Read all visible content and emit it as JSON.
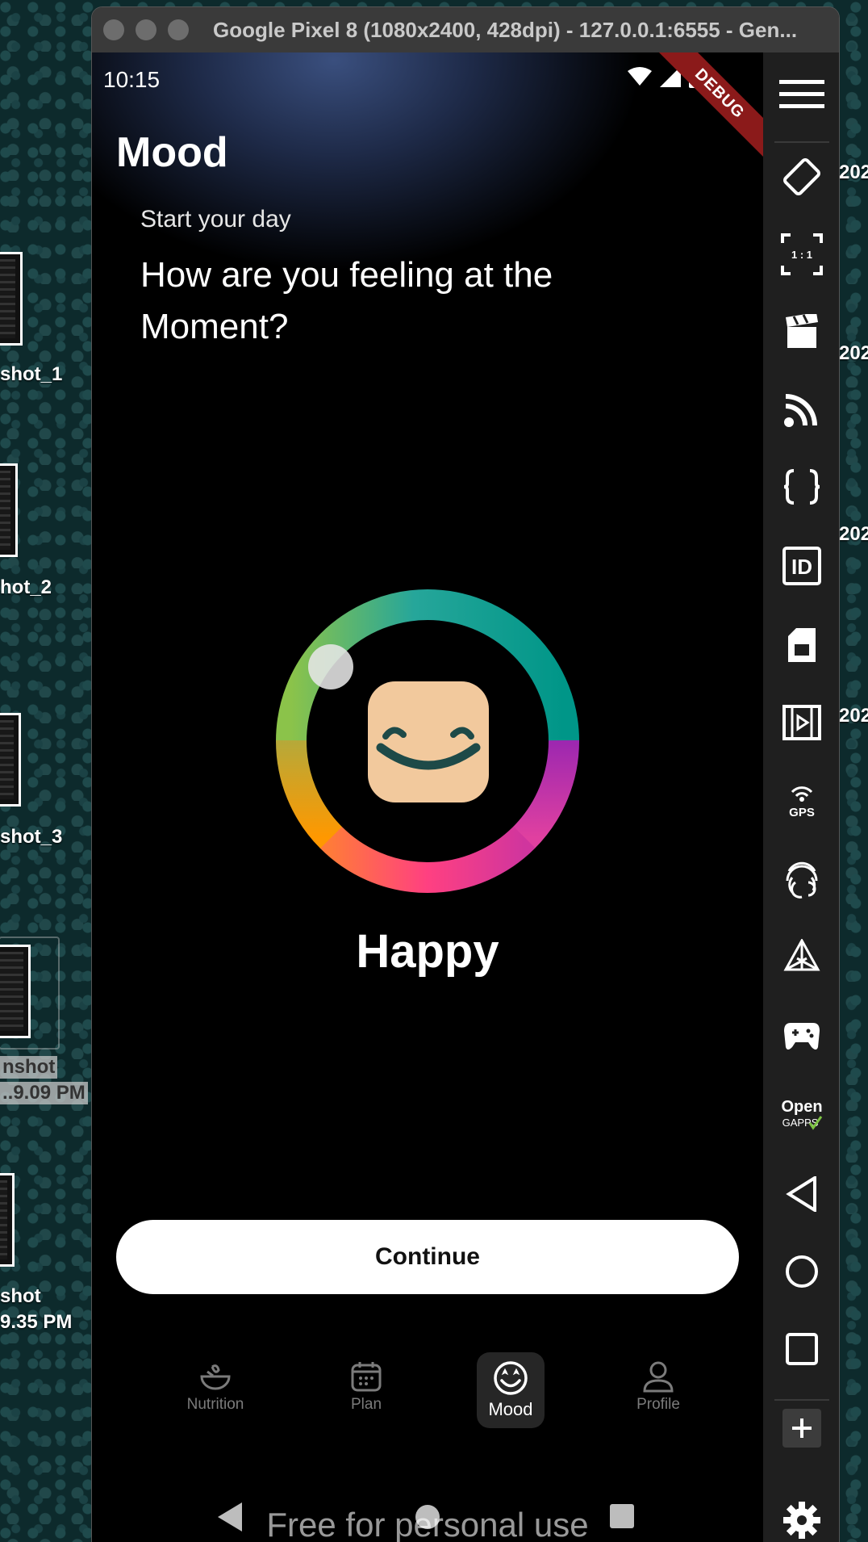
{
  "window": {
    "title": "Google Pixel 8 (1080x2400, 428dpi) - 127.0.0.1:6555 - Gen..."
  },
  "desktop": {
    "items": [
      {
        "label": "shot_1"
      },
      {
        "label": "hot_2"
      },
      {
        "label": "shot_3"
      },
      {
        "label_line1": "nshot",
        "label_line2": "..9.09 PM"
      },
      {
        "label_line1": "shot",
        "label_line2": "9.35 PM"
      }
    ],
    "right_labels": [
      "202",
      "202",
      "202",
      "202"
    ]
  },
  "status_bar": {
    "time": "10:15",
    "debug_banner": "DEBUG"
  },
  "app": {
    "page_title": "Mood",
    "subtitle": "Start your day",
    "question": "How are you feeling at the Moment?",
    "mood_label": "Happy",
    "continue_label": "Continue",
    "ring_colors": [
      "#009688",
      "#9c27b0",
      "#ff4081",
      "#ff9800",
      "#8bc34a"
    ],
    "face_color": "#f2c99d"
  },
  "bottom_nav": {
    "items": [
      {
        "label": "Nutrition",
        "icon": "bowl-icon",
        "active": false
      },
      {
        "label": "Plan",
        "icon": "calendar-icon",
        "active": false
      },
      {
        "label": "Mood",
        "icon": "mood-face-icon",
        "active": true
      },
      {
        "label": "Profile",
        "icon": "person-icon",
        "active": false
      }
    ]
  },
  "watermark": "Free for personal use",
  "toolbar": {
    "tools": [
      "menu-icon",
      "rotate-icon",
      "resize-1-1-icon",
      "clapper-icon",
      "cast-icon",
      "braces-icon",
      "id-icon",
      "sim-card-icon",
      "video-icon",
      "gps-icon",
      "fingerprint-icon",
      "sensors-icon",
      "gamepad-icon",
      "opengapps-icon",
      "back-icon",
      "home-icon",
      "overview-icon",
      "add-icon",
      "settings-icon"
    ],
    "id_label": "ID",
    "gps_label": "GPS",
    "resize_label": "1 : 1",
    "opengapps_label_1": "Open",
    "opengapps_label_2": "GAPPS"
  }
}
